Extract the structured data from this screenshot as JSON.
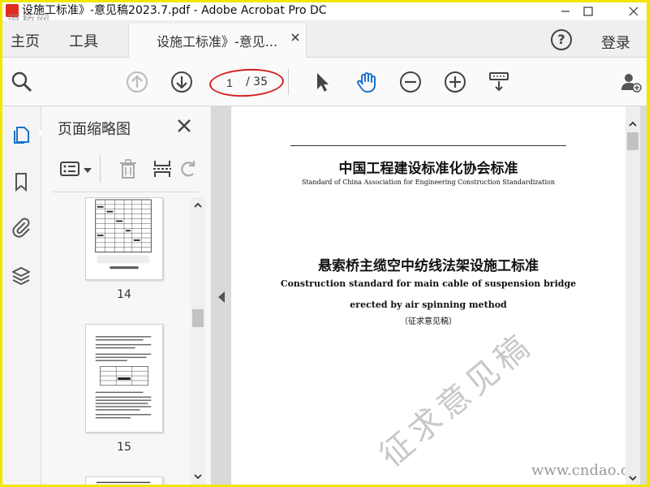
{
  "window": {
    "title": "设施工标准》-意见稿2023.7.pdf - Adobe Acrobat Pro DC",
    "watermark_logo": "道桥网"
  },
  "nav": {
    "home": "主页",
    "tools": "工具",
    "doc_tab": "设施工标准》-意见...",
    "login": "登录",
    "help": "?"
  },
  "toolbar": {
    "current_page": "1",
    "total_pages": "/ 35"
  },
  "panel": {
    "title": "页面缩略图",
    "thumbnails": [
      {
        "page": "14"
      },
      {
        "page": "15"
      }
    ]
  },
  "document": {
    "header_cn": "中国工程建设标准化协会标准",
    "header_en": "Standard of China Association for Engineering Construction Standardization",
    "title_cn": "悬索桥主缆空中纺线法架设施工标准",
    "title_en_1": "Construction standard for main cable of suspension bridge",
    "title_en_2": "erected by air spinning method",
    "draft_note": "（征求意见稿）",
    "watermark": "征求意见稿",
    "site_watermark": "www.cndao.com"
  },
  "colors": {
    "accent_blue": "#1a73c8",
    "annotation_red": "#d42020",
    "frame_yellow": "#f2e600"
  }
}
